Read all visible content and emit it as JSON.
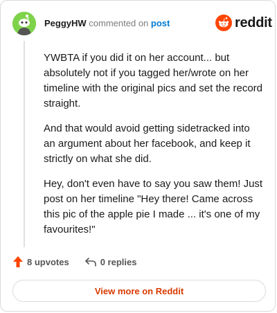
{
  "header": {
    "username": "PeggyHW",
    "commented_text": "commented on",
    "post_link": "post",
    "avatar_icon": "snoo-avatar-icon",
    "logo_icon": "reddit-alien-icon",
    "logo_text": "reddit"
  },
  "comment": {
    "paragraphs": [
      "YWBTA if you did it on her account... but absolutely not if you tagged her/wrote on her timeline with the original pics and set the record straight.",
      "And that would avoid getting sidetracked into an argument about her facebook, and keep it strictly on what she did.",
      "Hey, don't even have to say you saw them! Just post on her timeline \"Hey there! Came across this pic of the apple pie I made ... it's one of my favourites!\""
    ]
  },
  "actions": {
    "upvotes_label": "8 upvotes",
    "upvote_icon": "upvote-arrow-icon",
    "replies_label": "0 replies",
    "reply_icon": "reply-arrow-icon"
  },
  "footer": {
    "view_more_label": "View more on Reddit"
  },
  "colors": {
    "accent": "#ff4500",
    "link": "#0079d3",
    "view_more": "#d93a00",
    "avatar_bg": "#7fd34a"
  }
}
